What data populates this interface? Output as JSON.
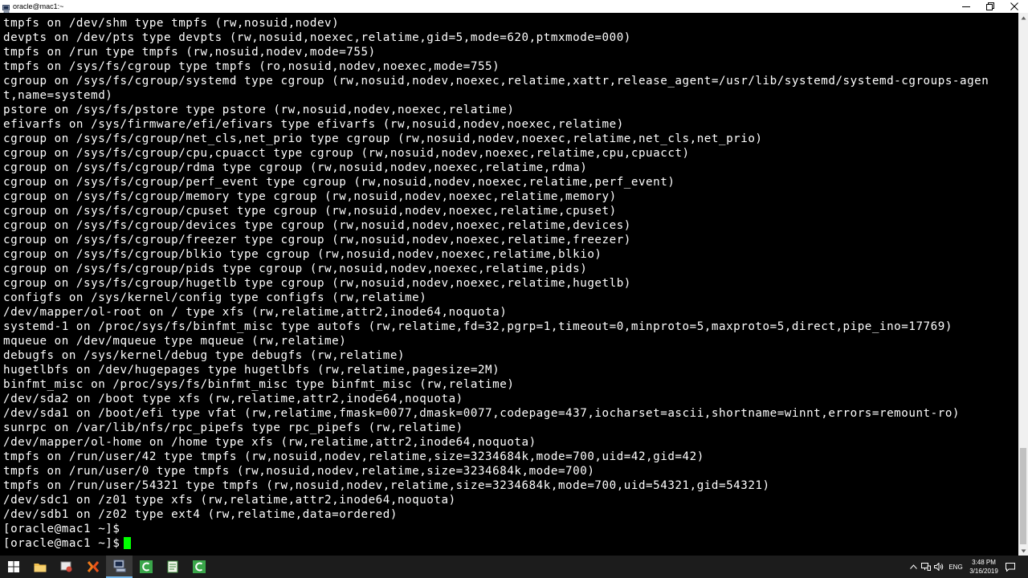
{
  "window": {
    "title": "oracle@mac1:~",
    "icon": "putty-terminal-icon"
  },
  "terminal": {
    "lines": [
      "tmpfs on /dev/shm type tmpfs (rw,nosuid,nodev)",
      "devpts on /dev/pts type devpts (rw,nosuid,noexec,relatime,gid=5,mode=620,ptmxmode=000)",
      "tmpfs on /run type tmpfs (rw,nosuid,nodev,mode=755)",
      "tmpfs on /sys/fs/cgroup type tmpfs (ro,nosuid,nodev,noexec,mode=755)",
      "cgroup on /sys/fs/cgroup/systemd type cgroup (rw,nosuid,nodev,noexec,relatime,xattr,release_agent=/usr/lib/systemd/systemd-cgroups-agen",
      "t,name=systemd)",
      "pstore on /sys/fs/pstore type pstore (rw,nosuid,nodev,noexec,relatime)",
      "efivarfs on /sys/firmware/efi/efivars type efivarfs (rw,nosuid,nodev,noexec,relatime)",
      "cgroup on /sys/fs/cgroup/net_cls,net_prio type cgroup (rw,nosuid,nodev,noexec,relatime,net_cls,net_prio)",
      "cgroup on /sys/fs/cgroup/cpu,cpuacct type cgroup (rw,nosuid,nodev,noexec,relatime,cpu,cpuacct)",
      "cgroup on /sys/fs/cgroup/rdma type cgroup (rw,nosuid,nodev,noexec,relatime,rdma)",
      "cgroup on /sys/fs/cgroup/perf_event type cgroup (rw,nosuid,nodev,noexec,relatime,perf_event)",
      "cgroup on /sys/fs/cgroup/memory type cgroup (rw,nosuid,nodev,noexec,relatime,memory)",
      "cgroup on /sys/fs/cgroup/cpuset type cgroup (rw,nosuid,nodev,noexec,relatime,cpuset)",
      "cgroup on /sys/fs/cgroup/devices type cgroup (rw,nosuid,nodev,noexec,relatime,devices)",
      "cgroup on /sys/fs/cgroup/freezer type cgroup (rw,nosuid,nodev,noexec,relatime,freezer)",
      "cgroup on /sys/fs/cgroup/blkio type cgroup (rw,nosuid,nodev,noexec,relatime,blkio)",
      "cgroup on /sys/fs/cgroup/pids type cgroup (rw,nosuid,nodev,noexec,relatime,pids)",
      "cgroup on /sys/fs/cgroup/hugetlb type cgroup (rw,nosuid,nodev,noexec,relatime,hugetlb)",
      "configfs on /sys/kernel/config type configfs (rw,relatime)",
      "/dev/mapper/ol-root on / type xfs (rw,relatime,attr2,inode64,noquota)",
      "systemd-1 on /proc/sys/fs/binfmt_misc type autofs (rw,relatime,fd=32,pgrp=1,timeout=0,minproto=5,maxproto=5,direct,pipe_ino=17769)",
      "mqueue on /dev/mqueue type mqueue (rw,relatime)",
      "debugfs on /sys/kernel/debug type debugfs (rw,relatime)",
      "hugetlbfs on /dev/hugepages type hugetlbfs (rw,relatime,pagesize=2M)",
      "binfmt_misc on /proc/sys/fs/binfmt_misc type binfmt_misc (rw,relatime)",
      "/dev/sda2 on /boot type xfs (rw,relatime,attr2,inode64,noquota)",
      "/dev/sda1 on /boot/efi type vfat (rw,relatime,fmask=0077,dmask=0077,codepage=437,iocharset=ascii,shortname=winnt,errors=remount-ro)",
      "sunrpc on /var/lib/nfs/rpc_pipefs type rpc_pipefs (rw,relatime)",
      "/dev/mapper/ol-home on /home type xfs (rw,relatime,attr2,inode64,noquota)",
      "tmpfs on /run/user/42 type tmpfs (rw,nosuid,nodev,relatime,size=3234684k,mode=700,uid=42,gid=42)",
      "tmpfs on /run/user/0 type tmpfs (rw,nosuid,nodev,relatime,size=3234684k,mode=700)",
      "tmpfs on /run/user/54321 type tmpfs (rw,nosuid,nodev,relatime,size=3234684k,mode=700,uid=54321,gid=54321)",
      "/dev/sdc1 on /z01 type xfs (rw,relatime,attr2,inode64,noquota)",
      "/dev/sdb1 on /z02 type ext4 (rw,relatime,data=ordered)",
      "[oracle@mac1 ~]$"
    ],
    "prompt": "[oracle@mac1 ~]$",
    "cursor_color": "#00ff00"
  },
  "taskbar": {
    "apps": [
      {
        "icon": "windows-start-icon"
      },
      {
        "icon": "file-explorer-icon"
      },
      {
        "icon": "disk-utility-icon"
      },
      {
        "icon": "xming-x-icon"
      },
      {
        "icon": "putty-terminal-icon"
      },
      {
        "icon": "green-c-app-icon"
      },
      {
        "icon": "notepad-icon"
      },
      {
        "icon": "green-c-app-icon"
      }
    ],
    "language": "ENG",
    "time": "3:48 PM",
    "date": "3/16/2019",
    "active_color": "#76b9ed"
  }
}
